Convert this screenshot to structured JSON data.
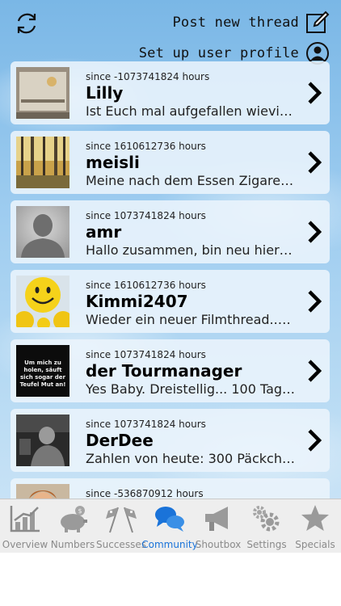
{
  "header": {
    "post_thread_label": "Post new thread",
    "user_profile_label": "Set up user profile"
  },
  "threads": [
    {
      "since": "since -1073741824 hours",
      "user": "Lilly",
      "preview": "Ist Euch mal aufgefallen wievi…",
      "avatar": "sign-photo"
    },
    {
      "since": "since 1610612736 hours",
      "user": "meisli",
      "preview": "Meine nach dem Essen Zigaret…",
      "avatar": "forest-photo"
    },
    {
      "since": "since 1073741824 hours",
      "user": "amr",
      "preview": "Hallo zusammen, bin neu hier…",
      "avatar": "default-silhouette"
    },
    {
      "since": "since 1610612736 hours",
      "user": "Kimmi2407",
      "preview": "Wieder ein neuer Filmthread..…",
      "avatar": "smileys-photo"
    },
    {
      "since": "since 1073741824 hours",
      "user": "der Tourmanager",
      "preview": "Yes Baby. Dreistellig... 100 Tag…",
      "avatar": "quote-image",
      "avatar_text": "Um mich zu holen, säuft sich sogar der Teufel Mut an!"
    },
    {
      "since": "since 1073741824 hours",
      "user": "DerDee",
      "preview": "Zahlen von heute: 300 Päckch…",
      "avatar": "bw-photo"
    },
    {
      "since": "since -536870912 hours",
      "user": "",
      "preview": "",
      "avatar": "portrait-photo"
    }
  ],
  "tabs": [
    {
      "label": "Overview",
      "icon": "chart-icon"
    },
    {
      "label": "Numbers",
      "icon": "piggy-bank-icon"
    },
    {
      "label": "Successes",
      "icon": "checkered-flags-icon"
    },
    {
      "label": "Community",
      "icon": "chat-bubbles-icon",
      "active": true
    },
    {
      "label": "Shoutbox",
      "icon": "megaphone-icon"
    },
    {
      "label": "Settings",
      "icon": "gears-icon"
    },
    {
      "label": "Specials",
      "icon": "star-icon"
    }
  ],
  "colors": {
    "active_tab": "#1a73d9",
    "inactive_tab": "#8a8a8a"
  }
}
